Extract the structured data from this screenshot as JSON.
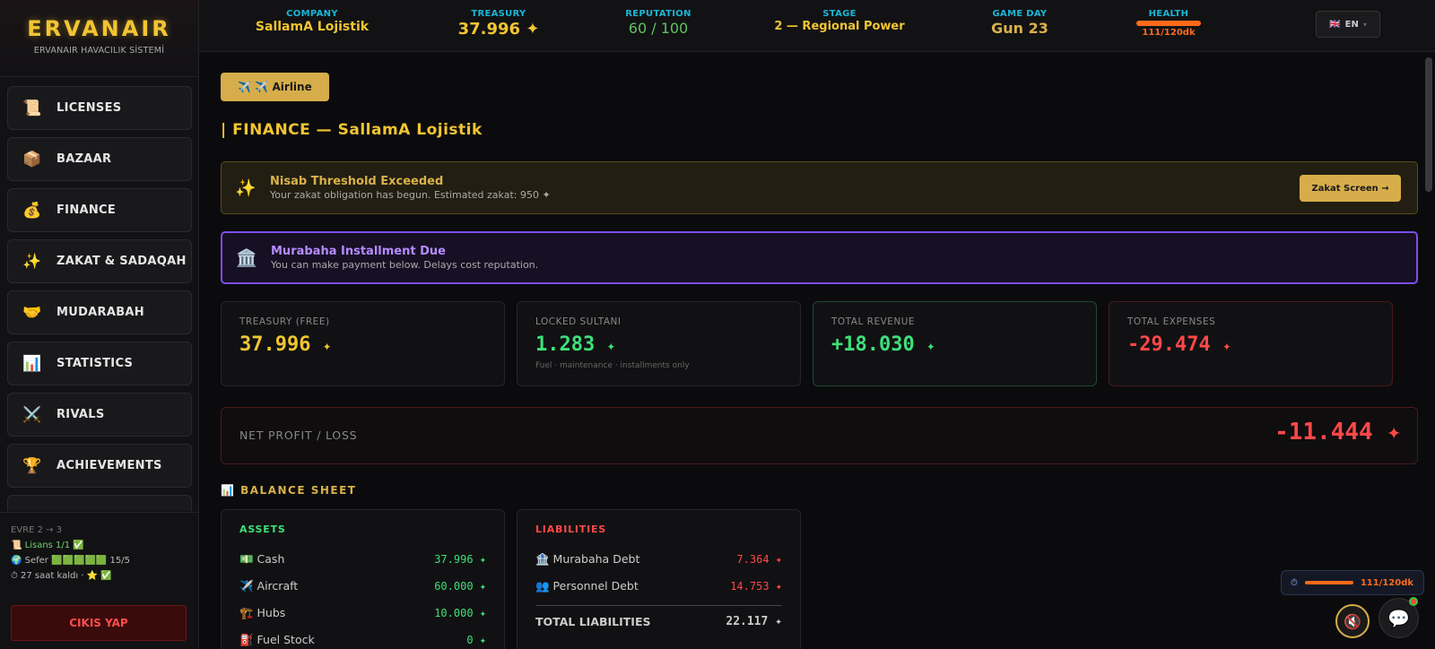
{
  "brand": {
    "title": "ERVANAIR",
    "subtitle": "ERVANAIR HAVACILIK SİSTEMİ"
  },
  "topbar": {
    "company": {
      "label": "COMPANY",
      "value": "SallamA Lojistik"
    },
    "treasury": {
      "label": "TREASURY",
      "value": "37.996 ✦"
    },
    "reputation": {
      "label": "REPUTATION",
      "value": "60 / 100"
    },
    "stage": {
      "label": "STAGE",
      "value": "2 — Regional Power"
    },
    "game_day": {
      "label": "GAME DAY",
      "value": "Gun 23"
    },
    "health": {
      "label": "HEALTH",
      "value": "111/120dk"
    },
    "language": {
      "flag": "🇬🇧",
      "code": "EN",
      "arrow": "▾"
    }
  },
  "sidebar": {
    "items": [
      {
        "icon": "📜",
        "label": "LICENSES"
      },
      {
        "icon": "📦",
        "label": "BAZAAR"
      },
      {
        "icon": "💰",
        "label": "FINANCE"
      },
      {
        "icon": "✨",
        "label": "ZAKAT & SADAQAH"
      },
      {
        "icon": "🤝",
        "label": "MUDARABAH"
      },
      {
        "icon": "📊",
        "label": "STATISTICS"
      },
      {
        "icon": "⚔️",
        "label": "RIVALS"
      },
      {
        "icon": "🏆",
        "label": "ACHIEVEMENTS"
      }
    ],
    "status": {
      "stage_progress": "EVRE 2 → 3",
      "license": "📜 Lisans 1/1 ✅",
      "flights": "🌍 Sefer 🟩🟩🟩🟩🟩 15/5",
      "time_left": "⏱ 27 saat kaldı · ⭐ ✅"
    },
    "logout_label": "CIKIS YAP"
  },
  "main": {
    "airline_button": "✈️ ✈️ Airline",
    "page_title": "| FINANCE — SallamA Lojistik",
    "alerts": {
      "nisab": {
        "icon": "✨",
        "title": "Nisab Threshold Exceeded",
        "desc": "Your zakat obligation has begun. Estimated zakat: 950 ✦",
        "button": "Zakat Screen →"
      },
      "murabaha": {
        "icon": "🏛️",
        "title": "Murabaha Installment Due",
        "desc": "You can make payment below. Delays cost reputation."
      }
    },
    "cards": [
      {
        "label": "TREASURY (FREE)",
        "value": "37.996",
        "coin": "✦",
        "note": ""
      },
      {
        "label": "LOCKED SULTANI",
        "value": "1.283",
        "coin": "✦",
        "note": "Fuel · maintenance · installments only"
      },
      {
        "label": "TOTAL REVENUE",
        "value": "+18.030",
        "coin": "✦",
        "note": ""
      },
      {
        "label": "TOTAL EXPENSES",
        "value": "-29.474",
        "coin": "✦",
        "note": ""
      }
    ],
    "net": {
      "label": "NET PROFIT / LOSS",
      "value": "-11.444 ✦"
    },
    "balance_sheet": {
      "title": "📊  BALANCE SHEET",
      "assets": {
        "header": "ASSETS",
        "rows": [
          {
            "label": "💵 Cash",
            "value": "37.996 ✦"
          },
          {
            "label": "✈️ Aircraft",
            "value": "60.000 ✦"
          },
          {
            "label": "🏗️ Hubs",
            "value": "10.000 ✦"
          },
          {
            "label": "⛽ Fuel Stock",
            "value": "0 ✦"
          }
        ]
      },
      "liabilities": {
        "header": "LIABILITIES",
        "rows": [
          {
            "label": "🏦 Murabaha Debt",
            "value": "7.364 ✦"
          },
          {
            "label": "👥 Personnel Debt",
            "value": "14.753 ✦"
          }
        ],
        "total": {
          "label": "TOTAL LIABILITIES",
          "value": "22.117 ✦"
        }
      }
    }
  },
  "floating": {
    "timer": {
      "icon": "⏱",
      "value": "111/120dk"
    },
    "mute_icon": "🔇",
    "chat_icon": "💬"
  }
}
